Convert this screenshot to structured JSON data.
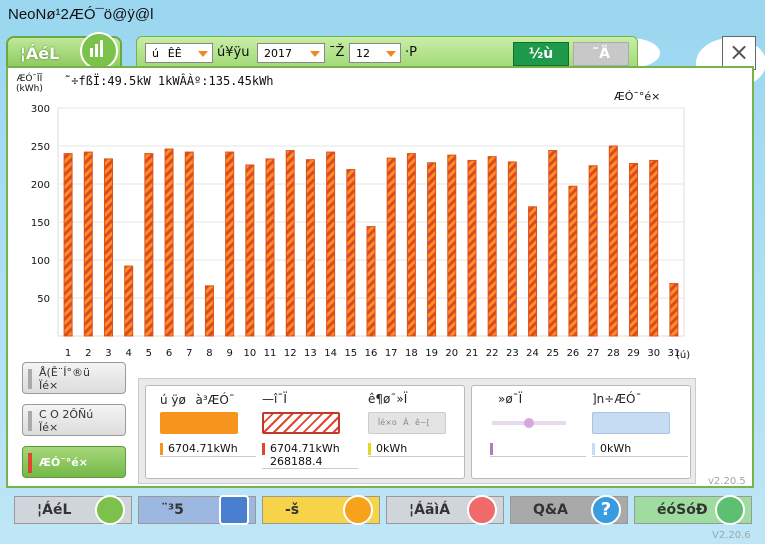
{
  "app": {
    "title": "NeoNø¹2ÆÓ¯ö@ÿ@l"
  },
  "tab": {
    "label": "¦ÁéL"
  },
  "toolbar": {
    "period_value": "úÊÊ",
    "date_label": "ú¥ÿu",
    "year_value": "2017",
    "year_label": "¯Ž",
    "month_value": "12",
    "month_label": "·P",
    "today_label": "½ù",
    "compare_label": "˜Ä"
  },
  "close": {
    "label": "×"
  },
  "info": {
    "capacity": "˜÷fßÏ:49.5kW  1kWÂÀº:135.45kWh",
    "y_unit_line1": "ÆÓ¯ÏÏ",
    "y_unit_line2": "(kWh)",
    "chart_title": "ÆÓ¯°é×"
  },
  "side_buttons": [
    {
      "label": "Å(Ê¨Í°®ü\nÏé×"
    },
    {
      "label": "C O 2ÔÑú\nÏé×"
    },
    {
      "label": "ÆÓ¯°é×"
    }
  ],
  "legend": {
    "solar": {
      "name": "ú ÿøà³ÆÓ¯",
      "value": "6704.71kWh",
      "color": "#f7941d"
    },
    "sold": {
      "name": "—î¯Ï",
      "value": "6704.71kWh",
      "value2": "268188.4",
      "color": "#e4432d"
    },
    "self": {
      "name": "ê¶ø¯»Ï",
      "note": "Ïé×oÂê~[",
      "value": "0kWh",
      "color": "#e6d820"
    },
    "bought": {
      "name": "»ø¯Ï",
      "value": "",
      "color": "#b07cc0"
    },
    "other": {
      "name": "]n÷ÆÓ¯",
      "value": "0kWh",
      "color": "#c5dcf2"
    }
  },
  "nav": [
    {
      "label": "¦ÁéL",
      "color": "#cfd5da",
      "icon": "bar-chart-icon",
      "icon_color": "#7cc24a"
    },
    {
      "label": "¨³5",
      "color": "#9db8e0",
      "icon": "notebook-icon",
      "icon_color": "#4a7ed0"
    },
    {
      "label": "-š",
      "color": "#f7d34a",
      "icon": "wrench-icon",
      "icon_color": "#f7a21a"
    },
    {
      "label": "¦ÁãìÁ",
      "color": "#cfd5da",
      "icon": "flag-icon",
      "icon_color": "#f06a6a"
    },
    {
      "label": "Q&A",
      "color": "#a9a9a9",
      "icon": "question-icon",
      "icon_color": "#3a9ce0"
    },
    {
      "label": "éóSóÐ",
      "color": "#9fdca0",
      "icon": "crown-icon",
      "icon_color": "#5dc070"
    }
  ],
  "versions": {
    "panel": "v2.20.5",
    "app": "V2.20.6"
  },
  "chart_data": {
    "type": "bar",
    "categories": [
      "1",
      "2",
      "3",
      "4",
      "5",
      "6",
      "7",
      "8",
      "9",
      "10",
      "11",
      "12",
      "13",
      "14",
      "15",
      "16",
      "17",
      "18",
      "19",
      "20",
      "21",
      "22",
      "23",
      "24",
      "25",
      "26",
      "27",
      "28",
      "29",
      "30",
      "31"
    ],
    "values": [
      240,
      242,
      233,
      92,
      240,
      246,
      242,
      66,
      242,
      225,
      233,
      244,
      232,
      242,
      219,
      144,
      234,
      240,
      228,
      238,
      231,
      236,
      229,
      170,
      244,
      197,
      224,
      250,
      227,
      231,
      69
    ],
    "x_unit": "(ú)",
    "ylim": [
      0,
      300
    ],
    "yticks": [
      50,
      100,
      150,
      200,
      250,
      300
    ],
    "grid": true,
    "bar_fill": "#f7941d",
    "bar_stripe": "#e4432d"
  }
}
